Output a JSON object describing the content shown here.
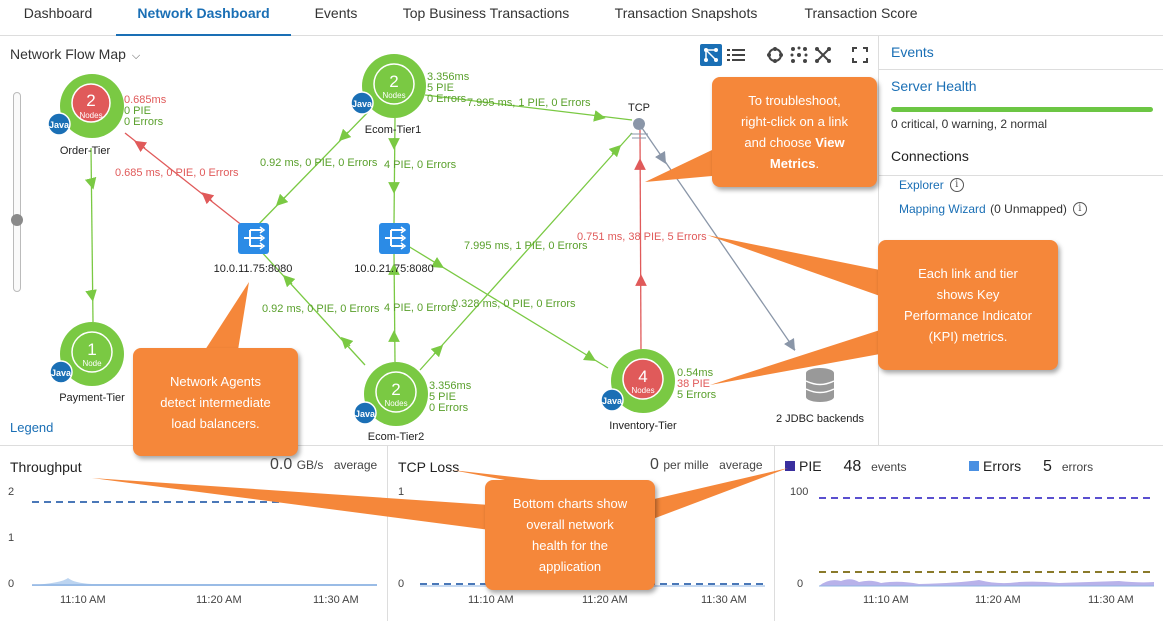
{
  "tabs": [
    {
      "label": "Dashboard"
    },
    {
      "label": "Network Dashboard"
    },
    {
      "label": "Events"
    },
    {
      "label": "Top Business Transactions"
    },
    {
      "label": "Transaction Snapshots"
    },
    {
      "label": "Transaction Score"
    }
  ],
  "map": {
    "title": "Network Flow Map",
    "legend": "Legend",
    "nodes": {
      "order": {
        "count": "2",
        "unit": "Nodes",
        "name": "Order-Tier",
        "badge": "Java",
        "m1": "0.685ms",
        "m2": "0 PIE",
        "m3": "0 Errors"
      },
      "ecom1": {
        "count": "2",
        "unit": "Nodes",
        "name": "Ecom-Tier1",
        "badge": "Java",
        "m1": "3.356ms",
        "m2": "5 PIE",
        "m3": "0 Errors"
      },
      "payment": {
        "count": "1",
        "unit": "Node",
        "name": "Payment-Tier",
        "badge": "Java"
      },
      "ecom2": {
        "count": "2",
        "unit": "Nodes",
        "name": "Ecom-Tier2",
        "badge": "Java",
        "m1": "3.356ms",
        "m2": "5 PIE",
        "m3": "0 Errors"
      },
      "inventory": {
        "count": "4",
        "unit": "Nodes",
        "name": "Inventory-Tier",
        "badge": "Java",
        "m1": "0.54ms",
        "m2": "38 PIE",
        "m3": "5 Errors"
      },
      "lb1": {
        "name": "10.0.11.75:8080"
      },
      "lb2": {
        "name": "10.0.21.75:8080"
      },
      "tcp": {
        "name": "TCP"
      },
      "jdbc": {
        "name": "2 JDBC backends"
      }
    },
    "links": {
      "ecom1_tcp": "7.995 ms, 1 PIE, 0 Errors",
      "lb1_order": "0.685 ms, 0 PIE, 0 Errors",
      "ecom1_lb1": "0.92 ms, 0 PIE, 0 Errors",
      "ecom1_lb2": "4 PIE, 0 Errors",
      "ecom2_tcp": "7.995 ms, 1 PIE, 0 Errors",
      "inv_tcp": "0.751 ms, 38 PIE, 5 Errors",
      "ecom2_lb1": "0.92 ms, 0 PIE, 0 Errors",
      "ecom2_lb2": "4 PIE, 0 Errors",
      "lb2_inv": "0.328 ms, 0 PIE, 0 Errors"
    }
  },
  "sidebar": {
    "events": "Events",
    "server_health": "Server Health",
    "health_text": "0 critical, 0 warning, 2 normal",
    "connections": "Connections",
    "explorer": "Explorer",
    "mapping_wizard": "Mapping Wizard",
    "unmapped": "(0 Unmapped)"
  },
  "charts": {
    "throughput": {
      "title": "Throughput",
      "value": "0.0",
      "unit": "GB/s",
      "agg": "average",
      "yticks": [
        "2",
        "1",
        "0"
      ],
      "xticks": [
        "11:10 AM",
        "11:20 AM",
        "11:30 AM"
      ]
    },
    "tcp_loss": {
      "title": "TCP Loss",
      "value": "0",
      "unit": "per mille",
      "agg": "average",
      "yticks": [
        "1",
        "0"
      ],
      "xticks": [
        "11:10 AM",
        "11:20 AM",
        "11:30 AM"
      ]
    },
    "pie": {
      "title": "PIE",
      "value": "48",
      "unit": "events",
      "err_title": "Errors",
      "err_value": "5",
      "err_unit": "errors",
      "yticks": [
        "100",
        "0"
      ],
      "xticks": [
        "11:10 AM",
        "11:20 AM",
        "11:30 AM"
      ],
      "pie_color": "#3a2f9e",
      "err_color": "#4a90e2"
    }
  },
  "callouts": {
    "troubleshoot_1": "To troubleshoot,",
    "troubleshoot_2": "right-click on a link",
    "troubleshoot_3": "and choose",
    "troubleshoot_bold": "View Metrics",
    "kpi_1": "Each link and tier",
    "kpi_2": "shows Key",
    "kpi_3": "Performance Indicator",
    "kpi_4": "(KPI) metrics.",
    "agents_1": "Network Agents",
    "agents_2": "detect intermediate",
    "agents_3": "load balancers.",
    "bottom_1": "Bottom charts show",
    "bottom_2": "overall network",
    "bottom_3": "health for the",
    "bottom_4": "application"
  },
  "colors": {
    "accent": "#1a6fb5",
    "healthy": "#6cc644",
    "critical": "#e05a5a",
    "link_green": "#7ac943",
    "link_red": "#e05a5a",
    "callout": "#f5873a"
  }
}
